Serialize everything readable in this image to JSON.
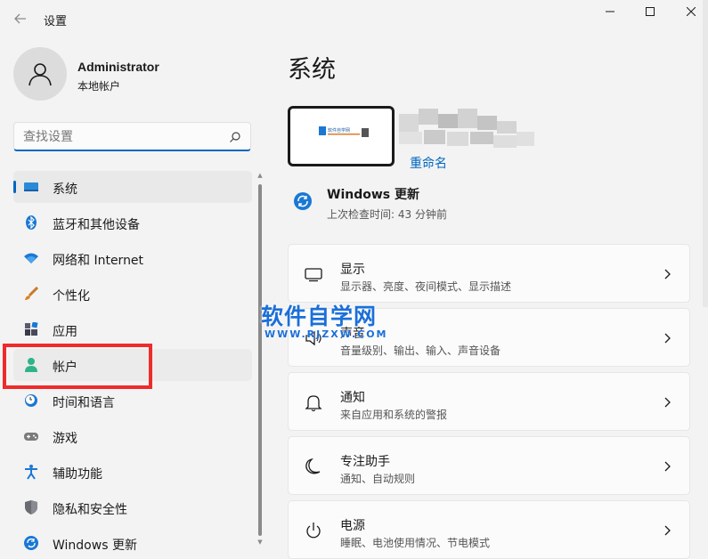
{
  "window": {
    "title": "设置"
  },
  "profile": {
    "name": "Administrator",
    "account_type": "本地帐户"
  },
  "search": {
    "placeholder": "查找设置"
  },
  "sidebar": {
    "items": [
      {
        "label": "系统",
        "icon": "system-icon",
        "selected": true
      },
      {
        "label": "蓝牙和其他设备",
        "icon": "bluetooth-icon"
      },
      {
        "label": "网络和 Internet",
        "icon": "wifi-icon"
      },
      {
        "label": "个性化",
        "icon": "brush-icon"
      },
      {
        "label": "应用",
        "icon": "apps-icon"
      },
      {
        "label": "帐户",
        "icon": "account-icon",
        "hovered": true
      },
      {
        "label": "时间和语言",
        "icon": "clock-globe-icon"
      },
      {
        "label": "游戏",
        "icon": "gamepad-icon"
      },
      {
        "label": "辅助功能",
        "icon": "accessibility-icon"
      },
      {
        "label": "隐私和安全性",
        "icon": "shield-icon"
      },
      {
        "label": "Windows 更新",
        "icon": "update-icon"
      }
    ]
  },
  "main": {
    "title": "系统",
    "device": {
      "rename_label": "重命名",
      "thumbnail_logo_text": "软件自学网"
    },
    "windows_update": {
      "title": "Windows 更新",
      "subtitle": "上次检查时间: 43 分钟前"
    },
    "cards": [
      {
        "title": "显示",
        "subtitle": "显示器、亮度、夜间模式、显示描述",
        "icon": "monitor-icon"
      },
      {
        "title": "声音",
        "subtitle": "音量级别、输出、输入、声音设备",
        "icon": "speaker-icon"
      },
      {
        "title": "通知",
        "subtitle": "来自应用和系统的警报",
        "icon": "bell-icon"
      },
      {
        "title": "专注助手",
        "subtitle": "通知、自动规则",
        "icon": "moon-icon"
      },
      {
        "title": "电源",
        "subtitle": "睡眠、电池使用情况、节电模式",
        "icon": "power-icon"
      }
    ]
  },
  "watermark": {
    "main": "软件自学网",
    "sub": "WWW.RJZXW.COM"
  },
  "colors": {
    "accent": "#0067c0",
    "highlight": "#ef2b2b",
    "background": "#f3f3f3"
  }
}
